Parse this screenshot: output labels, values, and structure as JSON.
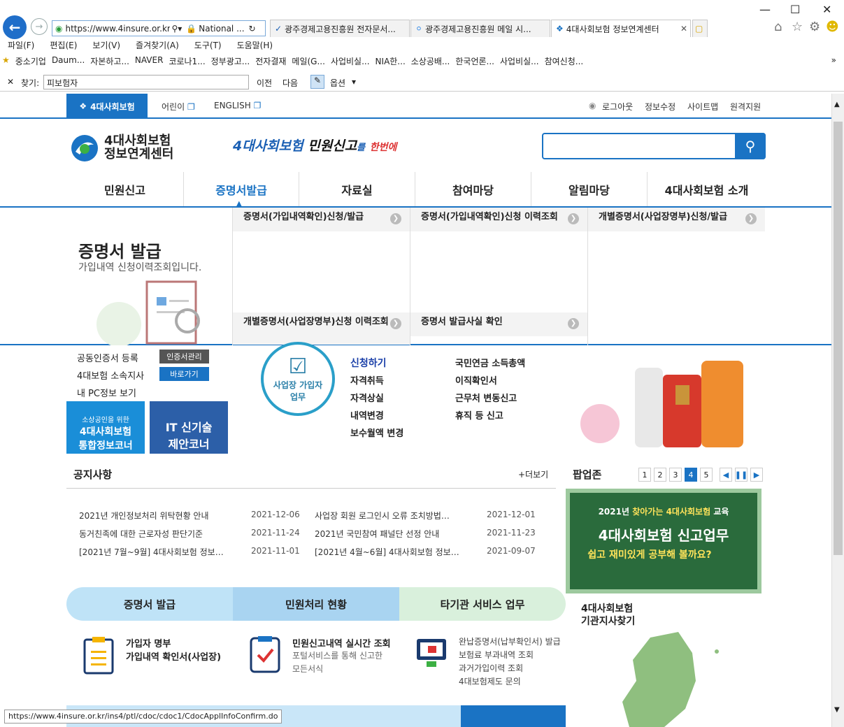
{
  "browser": {
    "url": "https://www.4insure.or.kr/i",
    "security": "National ...",
    "tabs": [
      {
        "title": "광주경제고용진흥원 전자문서..."
      },
      {
        "title": "광주경제고용진흥원 메일 시..."
      },
      {
        "title": "4대사회보험 정보연계센터"
      }
    ],
    "menu": [
      "파일(F)",
      "편집(E)",
      "보기(V)",
      "즐겨찾기(A)",
      "도구(T)",
      "도움말(H)"
    ],
    "favorites": [
      "중소기업",
      "Daum...",
      "자본하고...",
      "NAVER",
      "코로나1...",
      "정부광고...",
      "전자결재",
      "메일(G...",
      "사업비실...",
      "NIA한...",
      "소상공배...",
      "한국언론...",
      "사업비실...",
      "참여신청..."
    ],
    "find": {
      "label": "찾기:",
      "value": "피보험자",
      "prev": "이전",
      "next": "다음",
      "options": "옵션"
    },
    "status_url": "https://www.4insure.or.kr/ins4/ptl/cdoc/cdoc1/CdocApplInfoConfirm.do"
  },
  "site": {
    "brand_tab": "4대사회보험",
    "kids": "어린이",
    "english": "ENGLISH",
    "top_links": [
      "로그아웃",
      "정보수정",
      "사이트맵",
      "원격지원"
    ],
    "logo_line1": "4대사회보험",
    "logo_line2": "정보연계센터",
    "slogan_a": "4대사회보험",
    "slogan_b": "민원신고",
    "slogan_c": "를",
    "slogan_d": "한번에",
    "gnb": [
      "민원신고",
      "증명서발급",
      "자료실",
      "참여마당",
      "알림마당",
      "4대사회보험 소개"
    ],
    "mega": {
      "title": "증명서 발급",
      "subtitle": "가입내역 신청이력조회입니다.",
      "items": [
        "증명서(가입내역확인)신청/발급",
        "증명서(가입내역확인)신청 이력조회",
        "개별증명서(사업장명부)신청/발급",
        "개별증명서(사업장명부)신청 이력조회",
        "증명서 발급사실 확인"
      ]
    },
    "left_links": [
      "공동인증서 등록",
      "4대보험 소속지사",
      "내 PC정보 보기"
    ],
    "left_btns": [
      "인증서관리",
      "바로가기"
    ],
    "promo1_small": "소상공인을 위한",
    "promo1_line1": "4대사회보험",
    "promo1_line2": "통합정보코너",
    "promo2_line1": "IT 신기술",
    "promo2_line2": "제안코너",
    "workplace": {
      "badge_line1": "사업장 가입자",
      "badge_line2": "업무",
      "apply": "신청하기",
      "col1": [
        "자격취득",
        "자격상실",
        "내역변경",
        "보수월액 변경"
      ],
      "col2": [
        "국민연금 소득총액",
        "이직확인서",
        "근무처 변동신고",
        "휴직 등 신고"
      ]
    },
    "notice": {
      "title": "공지사항",
      "more": "+더보기",
      "left": [
        {
          "text": "2021년 개인정보처리 위탁현황 안내",
          "date": "2021-12-06"
        },
        {
          "text": "동거친족에 대한 근로자성 판단기준",
          "date": "2021-11-24"
        },
        {
          "text": "[2021년 7월~9월] 4대사회보험 정보…",
          "date": "2021-11-01"
        }
      ],
      "right": [
        {
          "text": "사업장 회원 로그인시 오류 조치방법…",
          "date": "2021-12-01"
        },
        {
          "text": "2021년 국민참여 패널단 선정 안내",
          "date": "2021-11-23"
        },
        {
          "text": "[2021년 4월~6월] 4대사회보험 정보…",
          "date": "2021-09-07"
        }
      ]
    },
    "popup": {
      "title": "팝업존",
      "pages": [
        "1",
        "2",
        "3",
        "4",
        "5"
      ],
      "current": "4",
      "banner_top_a": "2021년",
      "banner_top_b": "찾아가는",
      "banner_top_c": "4대사회보험",
      "banner_top_d": "교육",
      "banner_main": "4대사회보험 신고업무",
      "banner_sub": "쉽고 재미있게 공부해 볼까요?"
    },
    "branch": {
      "line1": "4대사회보험",
      "line2": "기관지사찾기"
    },
    "services": {
      "tabs": [
        "증명서 발급",
        "민원처리 현황",
        "타기관 서비스 업무"
      ],
      "cert": [
        "가입자 명부",
        "가입내역 확인서(사업장)"
      ],
      "status_title": "민원신고내역 실시간 조회",
      "status_desc1": "포털서비스를 통해 신고한",
      "status_desc2": "모든서식",
      "other": [
        "완납증명서(납부확인서) 발급",
        "보험료 부과내역 조회",
        "과거가입이력 조회",
        "4대보험제도 문의"
      ]
    }
  },
  "colors": {
    "primary": "#1a73c4",
    "board": "#2a6b3c",
    "cert_tab": "#bfe3f7",
    "status_tab": "#a9d4f1",
    "other_tab": "#d9f0dc"
  }
}
